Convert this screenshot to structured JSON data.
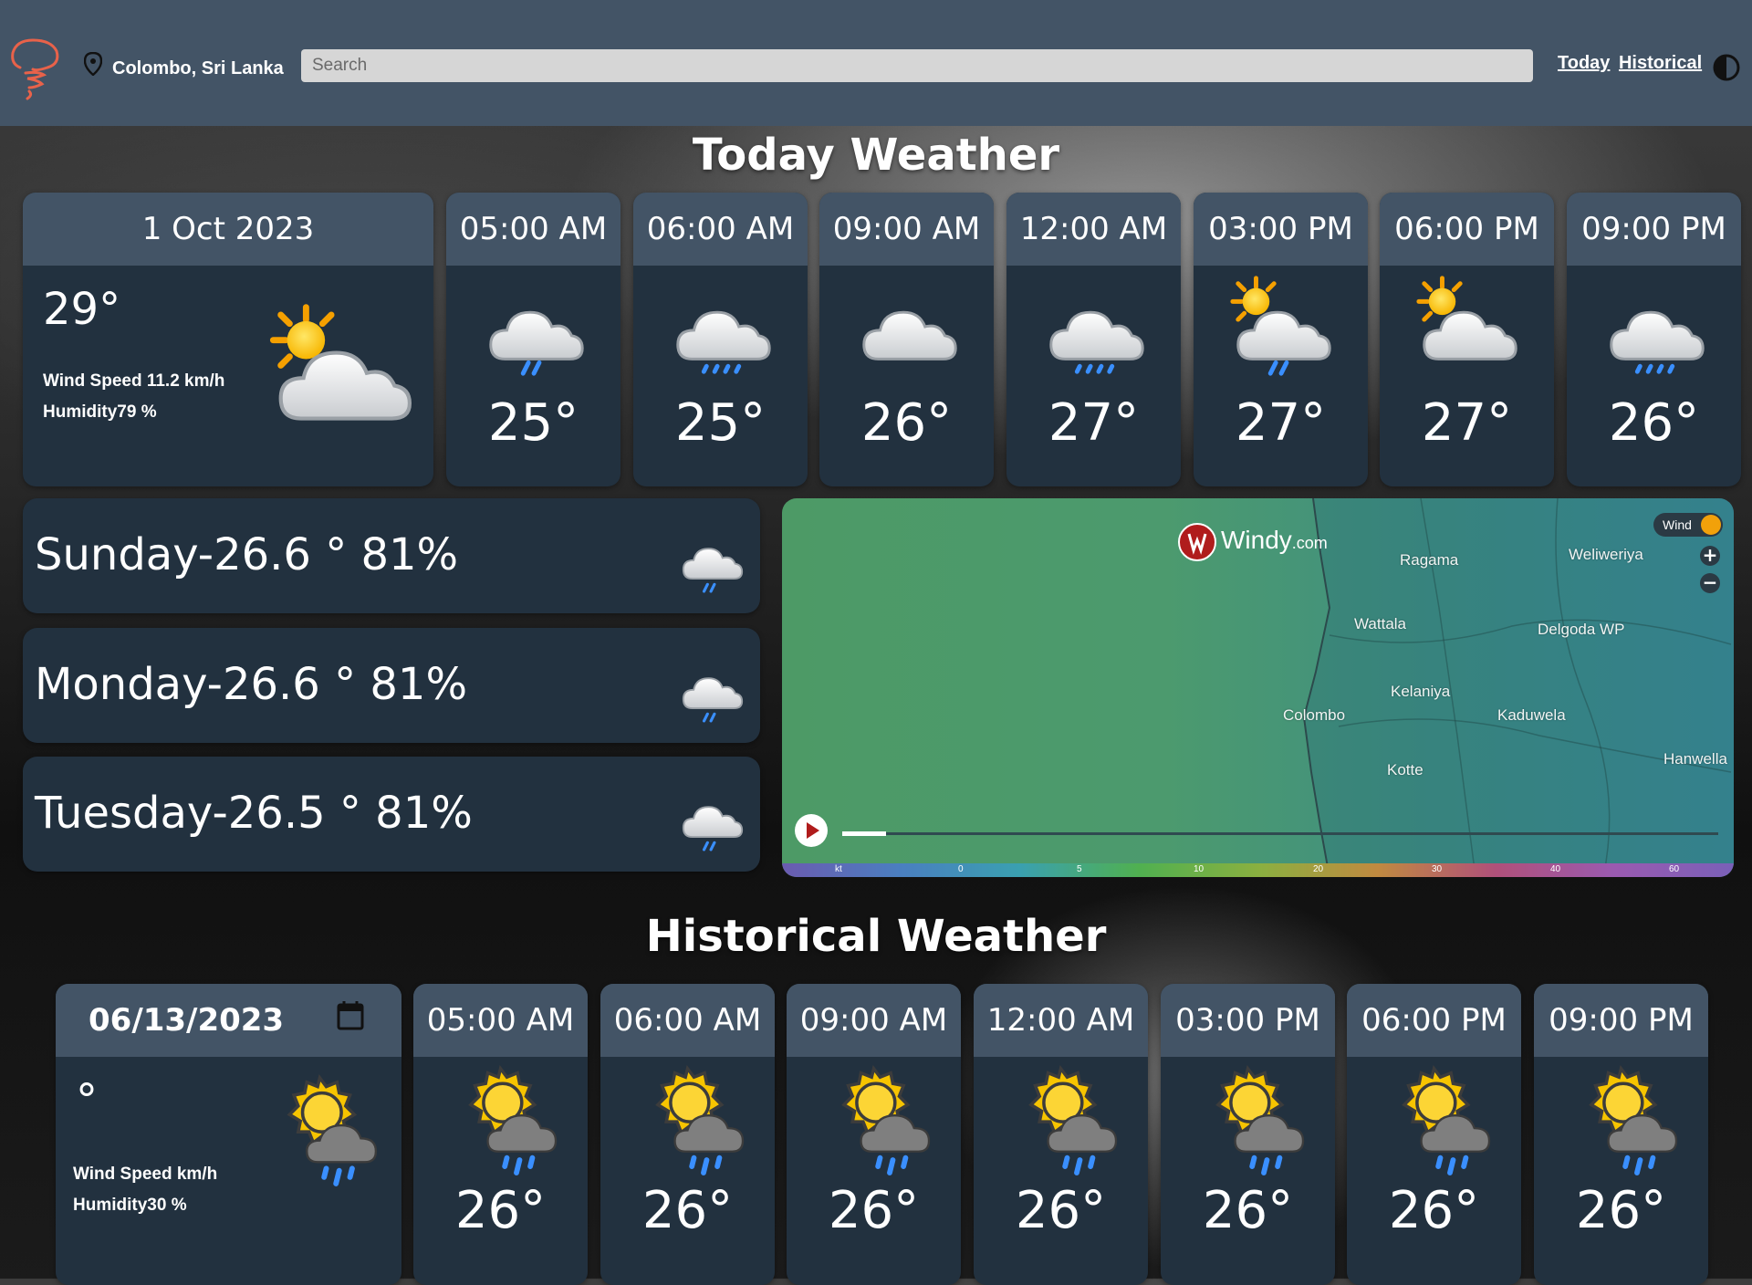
{
  "header": {
    "location": "Colombo, Sri Lanka",
    "search_placeholder": "Search",
    "nav": {
      "today": "Today",
      "historical": "Historical"
    }
  },
  "today": {
    "title": "Today Weather",
    "summary": {
      "date": "1 Oct 2023",
      "temp": "29°",
      "wind": "Wind Speed 11.2 km/h",
      "humidity": "Humidity79 %"
    },
    "hours": [
      {
        "time": "05:00 AM",
        "temp": "25°",
        "icon": "night-cloud-rain-icon"
      },
      {
        "time": "06:00 AM",
        "temp": "25°",
        "icon": "cloud-rain-icon"
      },
      {
        "time": "09:00 AM",
        "temp": "26°",
        "icon": "cloud-icon"
      },
      {
        "time": "12:00 AM",
        "temp": "27°",
        "icon": "cloud-rain-icon"
      },
      {
        "time": "03:00 PM",
        "temp": "27°",
        "icon": "sun-cloud-rain-icon"
      },
      {
        "time": "06:00 PM",
        "temp": "27°",
        "icon": "sun-cloud-icon"
      },
      {
        "time": "09:00 PM",
        "temp": "26°",
        "icon": "cloud-rain-icon"
      }
    ]
  },
  "forecast": [
    {
      "label": "Sunday-26.6 ° 81%"
    },
    {
      "label": "Monday-26.6 ° 81%"
    },
    {
      "label": "Tuesday-26.5 ° 81%"
    }
  ],
  "map": {
    "brand": "Windy",
    "brand_suffix": ".com",
    "layer": "Wind",
    "places": [
      "Ragama",
      "Weliweriya",
      "Wattala",
      "Delgoda WP",
      "Kelaniya",
      "Colombo",
      "Kaduwela",
      "Kotte",
      "Hanwella"
    ],
    "scale": [
      "kt",
      "0",
      "5",
      "10",
      "20",
      "30",
      "40",
      "60"
    ]
  },
  "historical": {
    "title": "Historical Weather",
    "summary": {
      "date": "06/13/2023",
      "temp": "°",
      "wind": "Wind Speed km/h",
      "humidity": "Humidity30 %"
    },
    "hours": [
      {
        "time": "05:00 AM",
        "temp": "26°"
      },
      {
        "time": "06:00 AM",
        "temp": "26°"
      },
      {
        "time": "09:00 AM",
        "temp": "26°"
      },
      {
        "time": "12:00 AM",
        "temp": "26°"
      },
      {
        "time": "03:00 PM",
        "temp": "26°"
      },
      {
        "time": "06:00 PM",
        "temp": "26°"
      },
      {
        "time": "09:00 PM",
        "temp": "26°"
      }
    ]
  }
}
